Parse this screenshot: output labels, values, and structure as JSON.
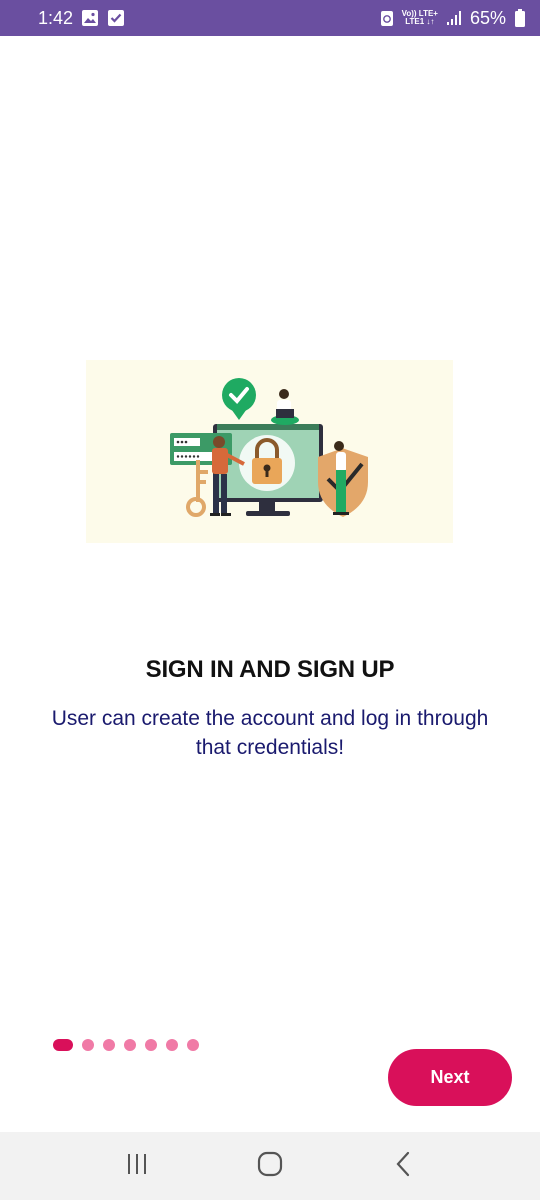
{
  "status_bar": {
    "time": "1:42",
    "network_top": "Vo)) LTE+",
    "network_bottom": "LTE1 ↓↑",
    "battery": "65%",
    "icons": [
      "gallery-icon",
      "checkbox-notification-icon",
      "data-saver-icon",
      "signal-icon",
      "battery-icon"
    ]
  },
  "onboarding": {
    "title": "SIGN IN AND SIGN UP",
    "subtitle": "User can create the account and log in through that credentials!",
    "page_index": 1,
    "page_count": 7,
    "next_label": "Next"
  },
  "nav_bar": {
    "icons": [
      "recent-apps-icon",
      "home-icon",
      "back-icon"
    ]
  },
  "colors": {
    "status_bar": "#6a4fa0",
    "accent": "#d9105a",
    "dot_inactive": "#f07aa6",
    "subtitle_text": "#1a1a6e",
    "illustration_bg": "#fdfbea"
  }
}
